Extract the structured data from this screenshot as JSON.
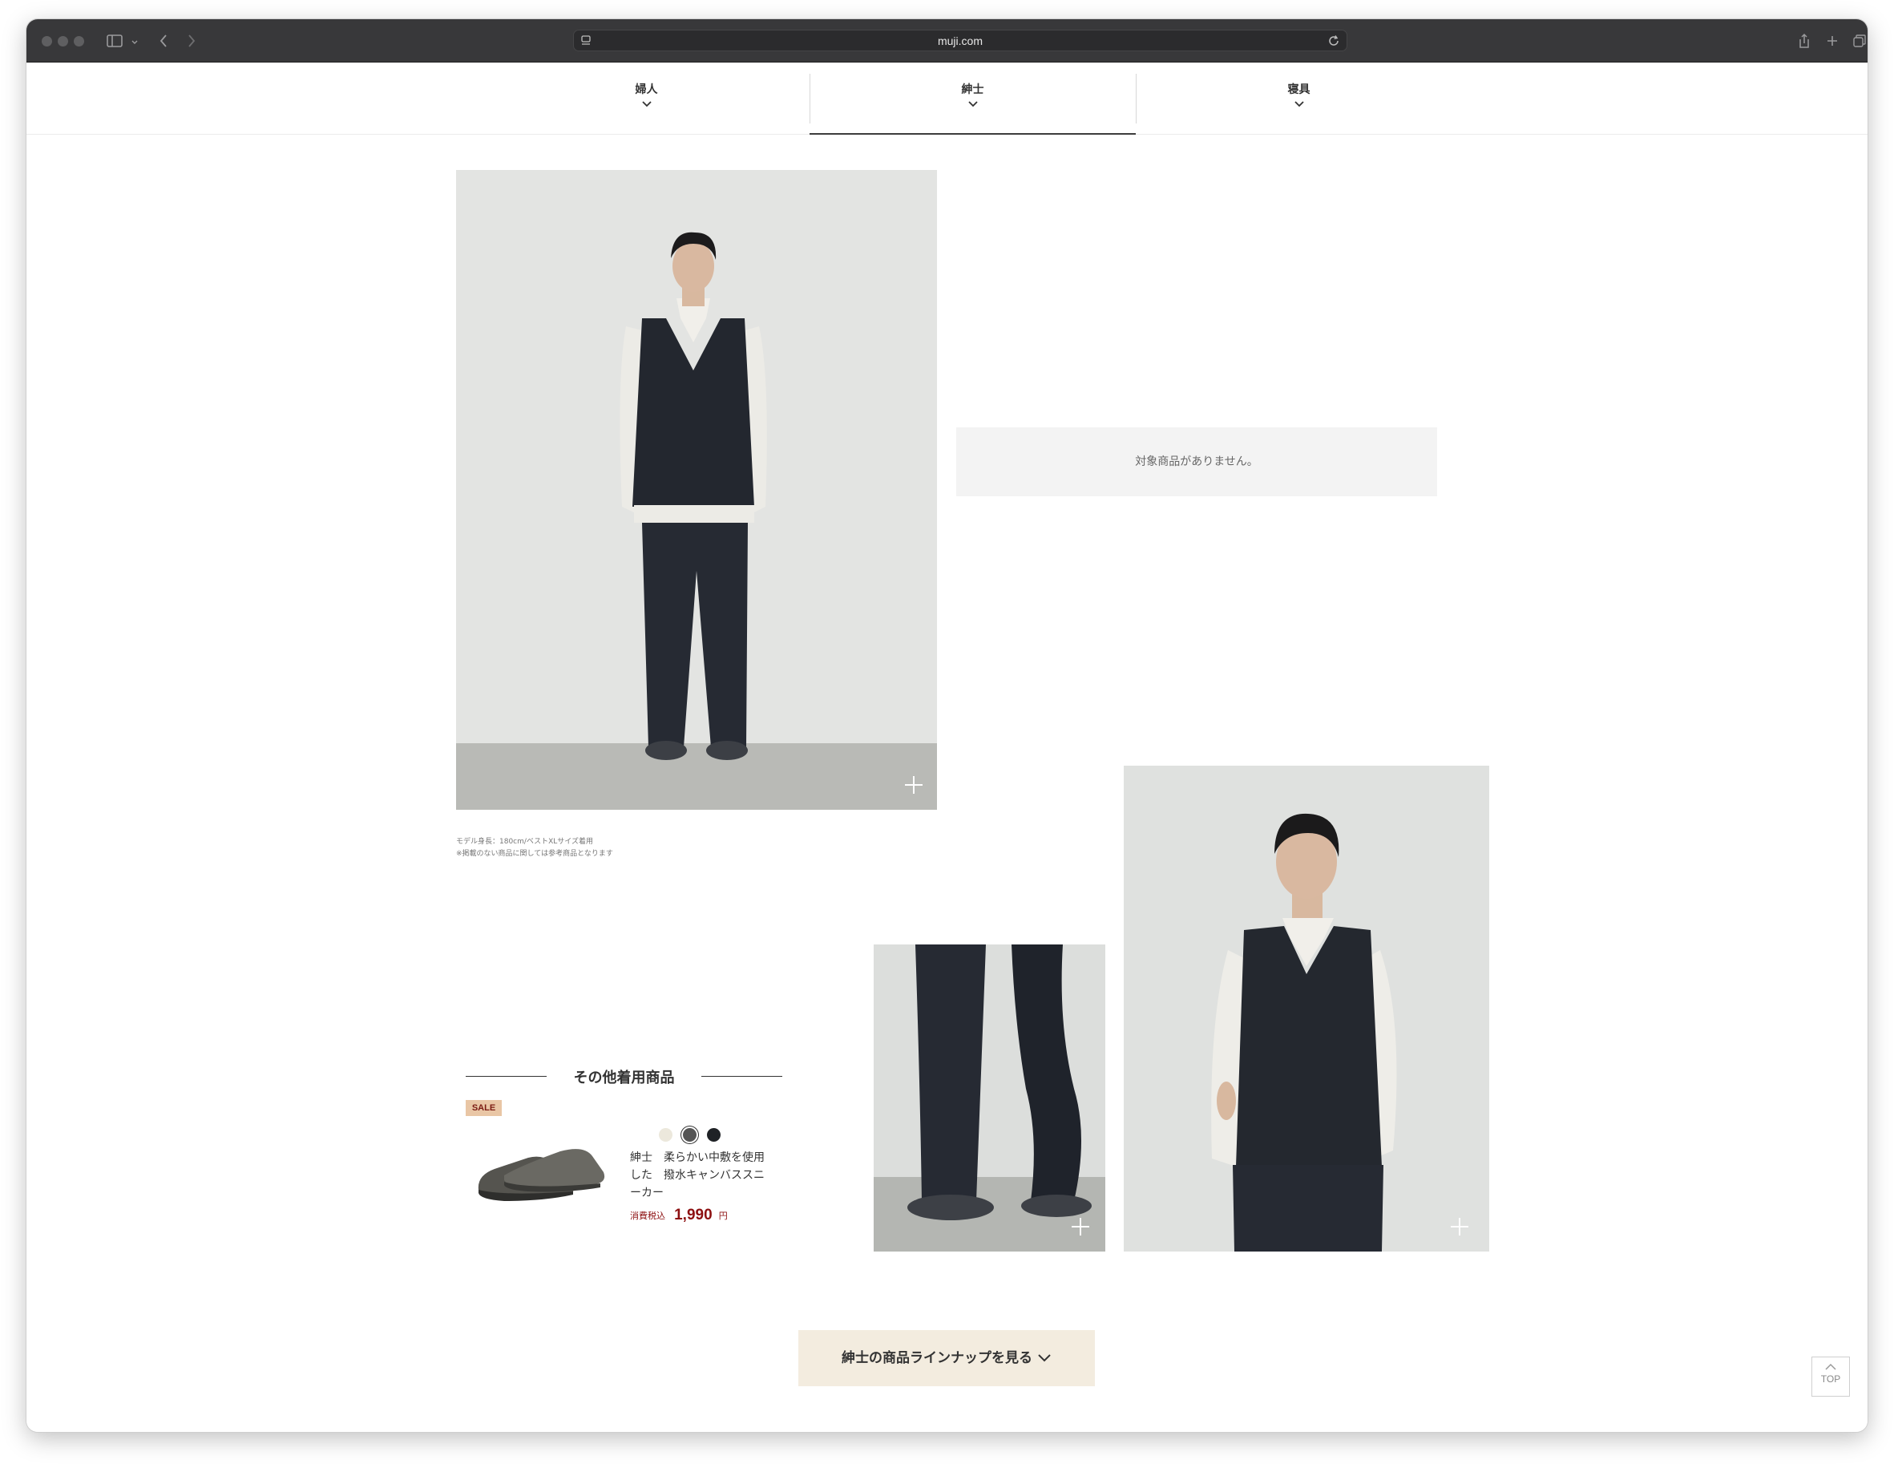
{
  "browser": {
    "url": "muji.com"
  },
  "category_nav": {
    "items": [
      {
        "label": "婦人"
      },
      {
        "label": "紳士"
      },
      {
        "label": "寝具"
      }
    ]
  },
  "main_photo": {
    "caption_line1": "モデル身長：180cm/ベストXLサイズ着用",
    "caption_line2": "※掲載のない商品に関しては参考商品となります"
  },
  "empty_message": "対象商品がありません。",
  "other_items": {
    "title": "その他着用商品",
    "product": {
      "badge": "SALE",
      "swatches": [
        "#ece8dc",
        "#555555",
        "#1f2226"
      ],
      "name": "紳士　柔らかい中敷を使用した　撥水キャンバススニーカー",
      "tax_label": "消費税込",
      "price": "1,990",
      "currency": "円"
    }
  },
  "lineup_button": {
    "label": "紳士の商品ラインナップを見る"
  },
  "top_button": {
    "label": "TOP"
  }
}
